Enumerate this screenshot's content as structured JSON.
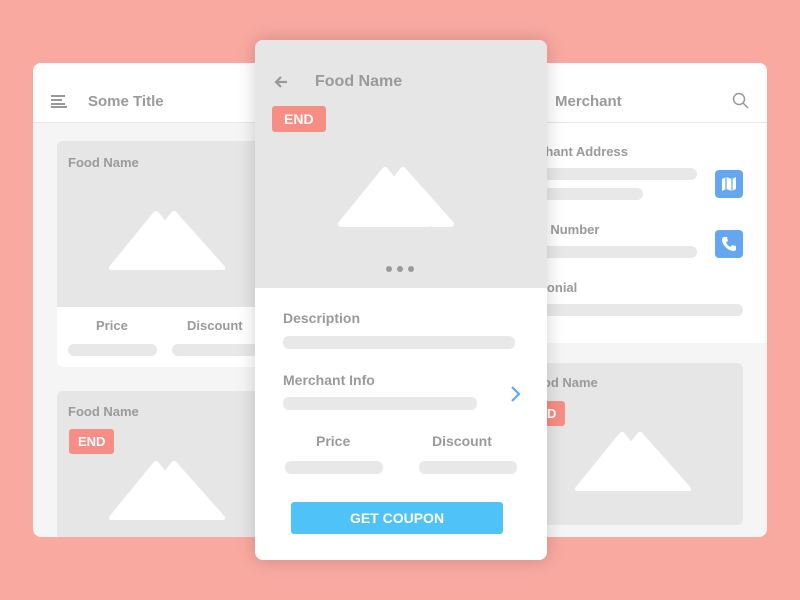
{
  "left": {
    "title": "Some Title",
    "menu_icon": "menu-icon",
    "items": [
      {
        "name": "Food Name",
        "price_label": "Price",
        "discount_label": "Discount"
      },
      {
        "name": "Food Name",
        "badge": "END"
      }
    ]
  },
  "center": {
    "back_icon": "arrow-left-icon",
    "title": "Food Name",
    "badge": "END",
    "description_label": "Description",
    "merchant_info_label": "Merchant Info",
    "price_label": "Price",
    "discount_label": "Discount",
    "button": "GET COUPON"
  },
  "right": {
    "title": "Merchant",
    "search_icon": "search-icon",
    "address_label": "Merchant Address",
    "phone_label": "Phone Number",
    "testimonial_label": "Testimonial",
    "item": {
      "name": "Food Name",
      "badge": "END"
    }
  },
  "colors": {
    "background": "#f9a9a0",
    "badge": "#f78e85",
    "button": "#4fc3f7",
    "icon": "#64a6ef"
  }
}
